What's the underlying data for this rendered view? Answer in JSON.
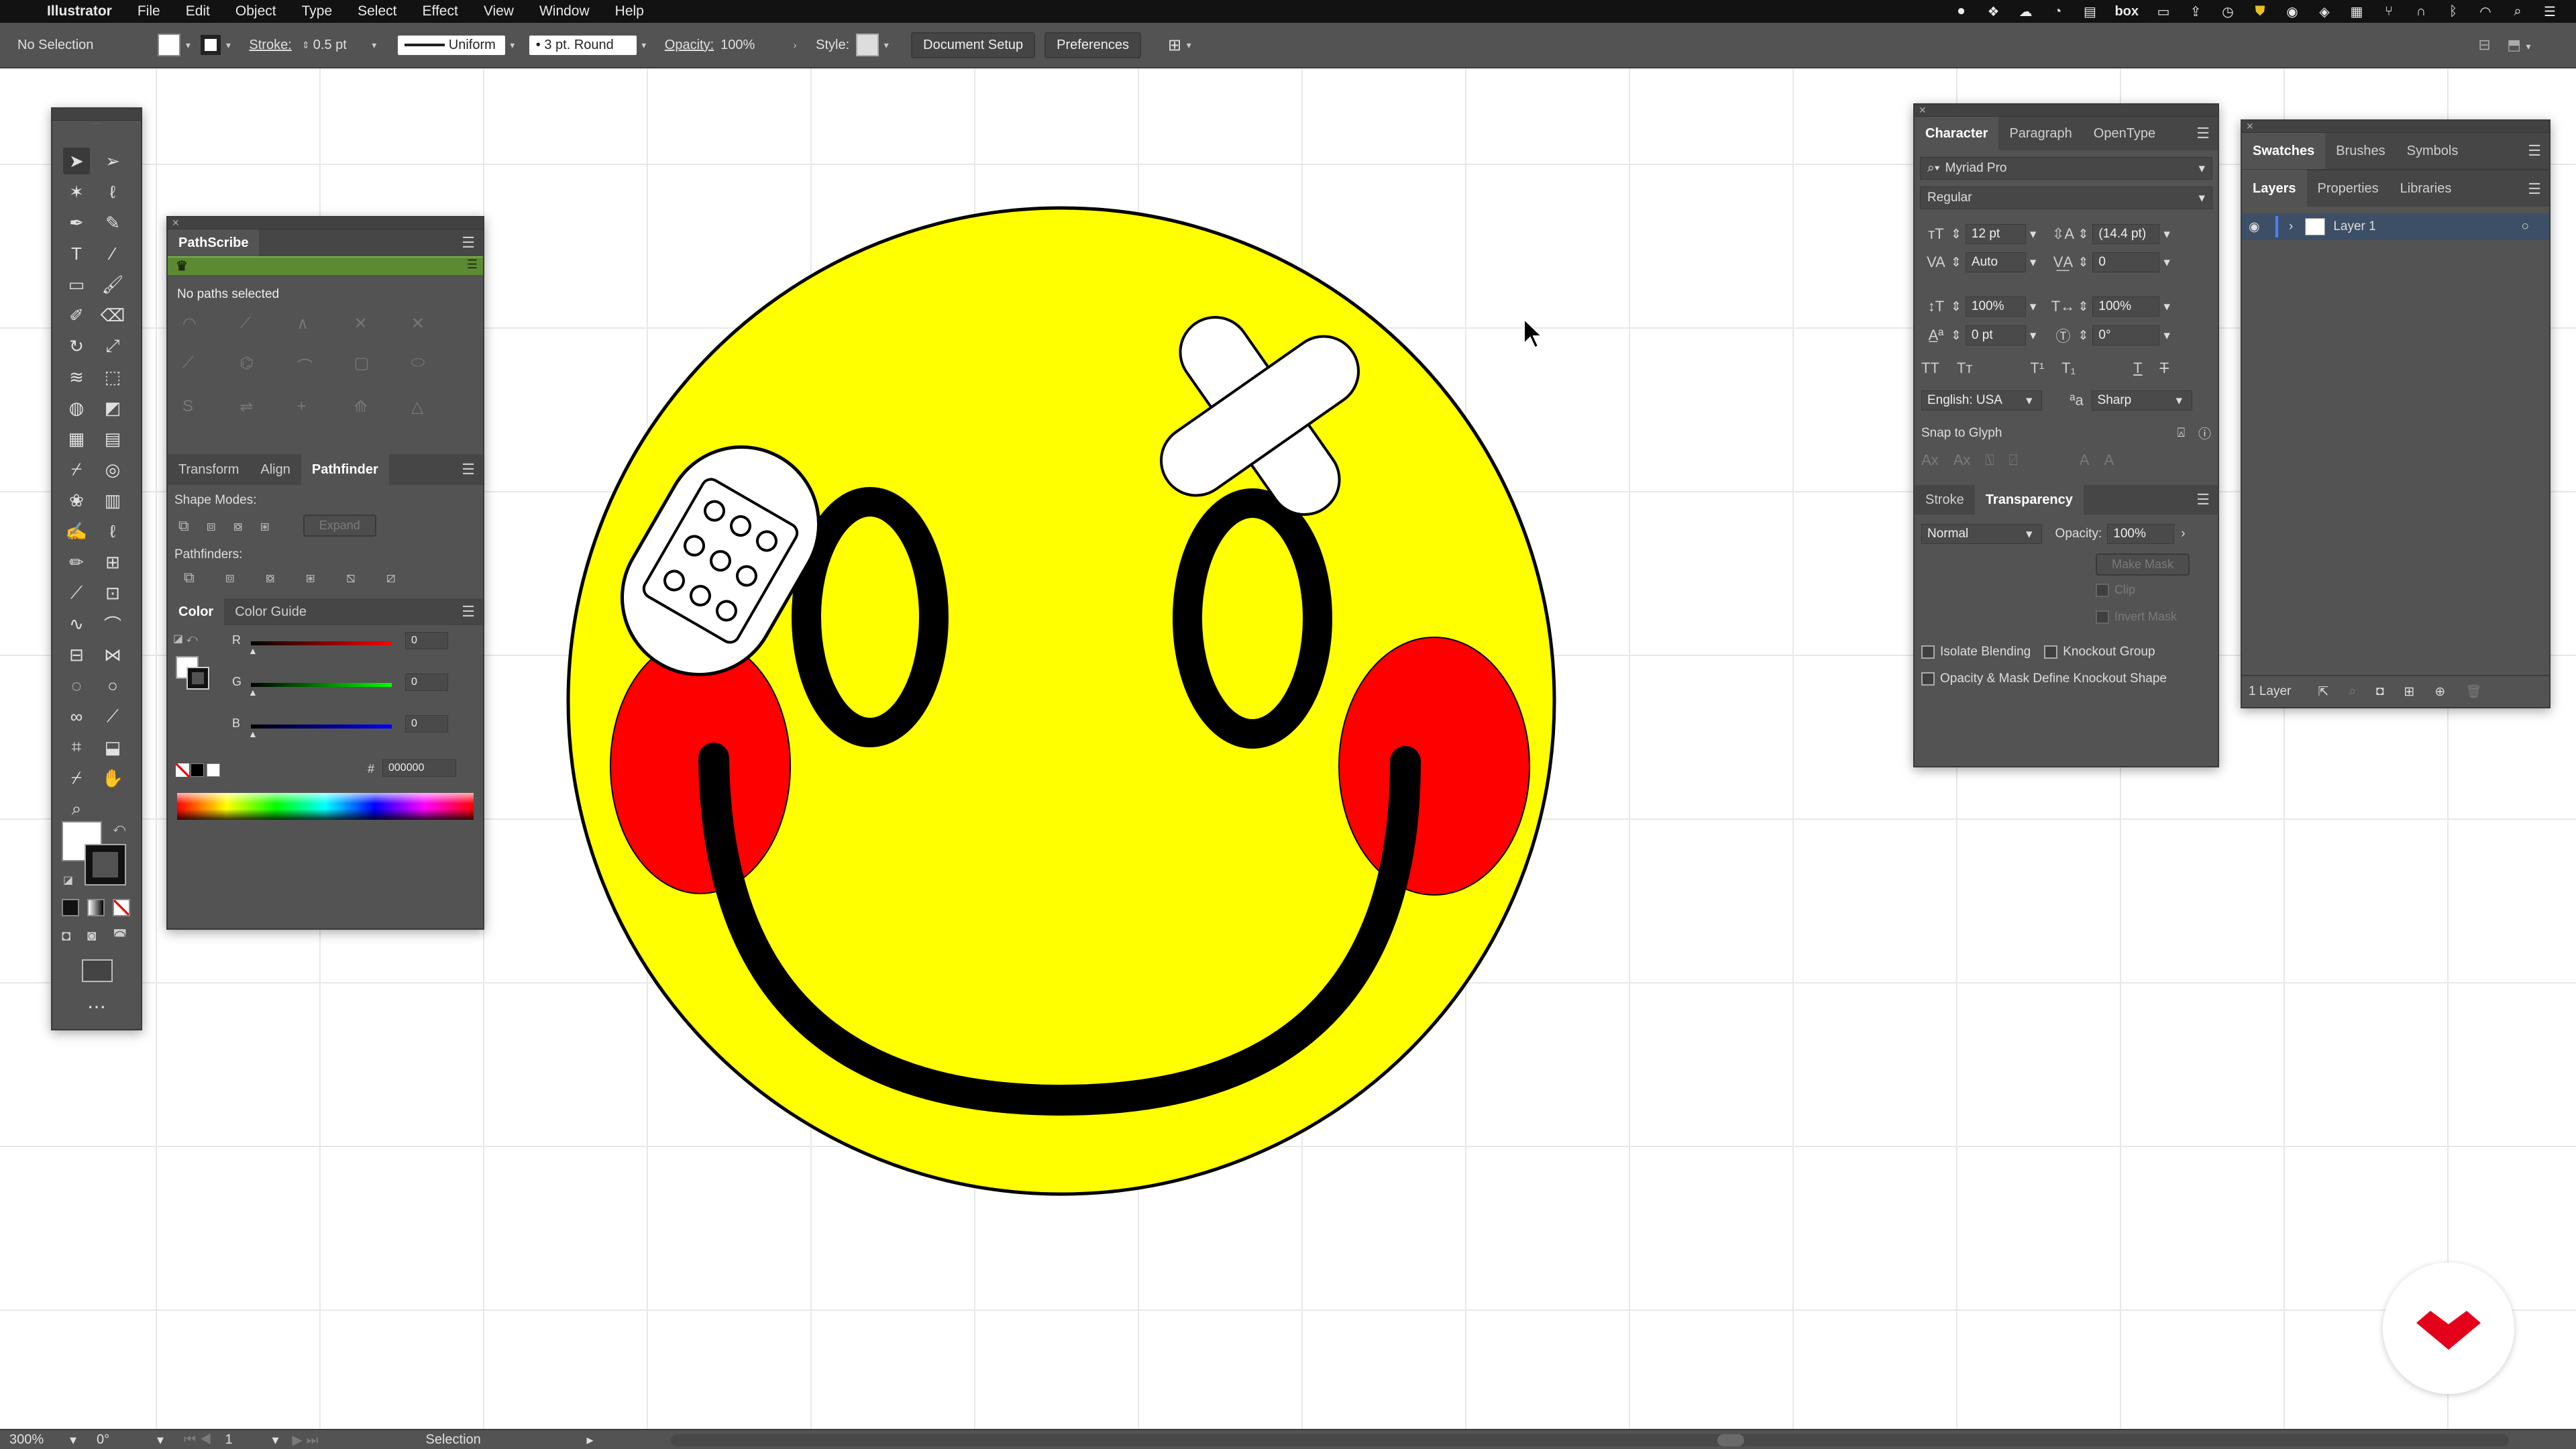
{
  "menubar": {
    "app_name": "Illustrator",
    "items": [
      "File",
      "Edit",
      "Object",
      "Type",
      "Select",
      "Effect",
      "View",
      "Window",
      "Help"
    ]
  },
  "control_bar": {
    "selection_state": "No Selection",
    "stroke_label": "Stroke:",
    "stroke_weight": "0.5 pt",
    "profile": "Uniform",
    "brush": "3 pt. Round",
    "opacity_label": "Opacity:",
    "opacity_value": "100%",
    "style_label": "Style:",
    "document_setup": "Document Setup",
    "preferences": "Preferences"
  },
  "pathscribe": {
    "title": "PathScribe",
    "status": "No paths selected"
  },
  "pathfinder_panel": {
    "tabs": [
      "Transform",
      "Align",
      "Pathfinder"
    ],
    "active_tab": "Pathfinder",
    "shape_modes_label": "Shape Modes:",
    "expand": "Expand",
    "pathfinders_label": "Pathfinders:"
  },
  "color_panel": {
    "tabs": [
      "Color",
      "Color Guide"
    ],
    "r_label": "R",
    "r_value": "0",
    "g_label": "G",
    "g_value": "0",
    "b_label": "B",
    "b_value": "0",
    "hex_label": "#",
    "hex_value": "000000"
  },
  "character_panel": {
    "tabs": [
      "Character",
      "Paragraph",
      "OpenType"
    ],
    "font_family": "Myriad Pro",
    "font_style": "Regular",
    "font_size": "12 pt",
    "leading": "(14.4 pt)",
    "kerning": "Auto",
    "tracking": "0",
    "vertical_scale": "100%",
    "horizontal_scale": "100%",
    "baseline_shift": "0 pt",
    "rotation": "0°",
    "language": "English: USA",
    "antialias": "Sharp",
    "snap_to_glyph": "Snap to Glyph"
  },
  "transparency_panel": {
    "tabs": [
      "Stroke",
      "Transparency"
    ],
    "blend_mode": "Normal",
    "opacity_label": "Opacity:",
    "opacity_value": "100%",
    "make_mask": "Make Mask",
    "clip": "Clip",
    "invert_mask": "Invert Mask",
    "isolate_blending": "Isolate Blending",
    "knockout_group": "Knockout Group",
    "opacity_mask_knockout": "Opacity & Mask Define Knockout Shape"
  },
  "swatches_panel": {
    "tabs": [
      "Swatches",
      "Brushes",
      "Symbols"
    ]
  },
  "layers_panel": {
    "tabs": [
      "Layers",
      "Properties",
      "Libraries"
    ],
    "layer_name": "Layer 1",
    "layer_count": "1 Layer"
  },
  "status_bar": {
    "zoom": "300%",
    "rotation": "0°",
    "artboard": "1",
    "tool": "Selection"
  },
  "colors": {
    "face": "#ffff00",
    "cheek": "#ff0000",
    "outline": "#000000",
    "ui_panel": "#535353",
    "brand_badge": "#e4001b"
  }
}
